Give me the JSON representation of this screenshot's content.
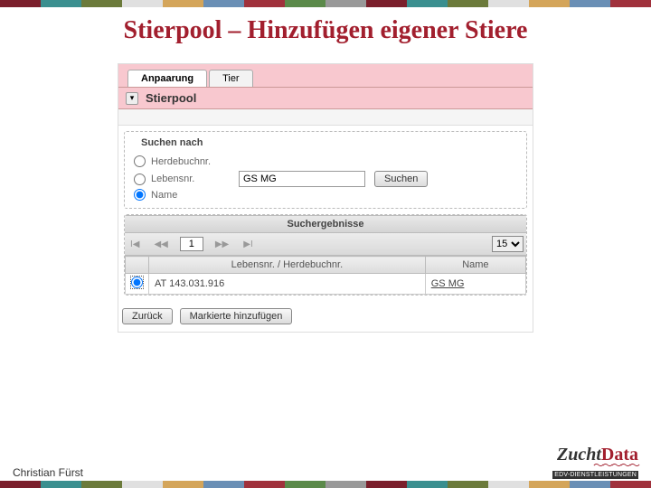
{
  "title": "Stierpool – Hinzufügen eigener Stiere",
  "tabs": {
    "active": "Anpaarung",
    "other": "Tier"
  },
  "section": {
    "title": "Stierpool"
  },
  "search": {
    "legend": "Suchen nach",
    "options": [
      "Herdebuchnr.",
      "Lebensnr.",
      "Name"
    ],
    "selected_index": 2,
    "value": "GS MG",
    "button": "Suchen"
  },
  "results": {
    "header": "Suchergebnisse",
    "page": "1",
    "page_size": "15",
    "columns": [
      "Lebensnr. / Herdebuchnr.",
      "Name"
    ],
    "rows": [
      {
        "id": "AT 143.031.916",
        "name": "GS MG"
      }
    ]
  },
  "actions": {
    "back": "Zurück",
    "add": "Markierte hinzufügen"
  },
  "footer": {
    "author": "Christian Fürst",
    "logo_z": "Zucht",
    "logo_d": "Data",
    "logo_tag": "EDV-DIENSTLEISTUNGEN"
  }
}
